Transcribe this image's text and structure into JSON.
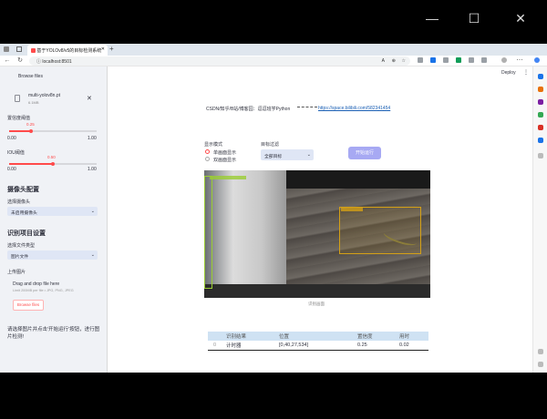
{
  "window": {
    "minimize_glyph": "—",
    "maximize_glyph": "☐",
    "close_glyph": "✕"
  },
  "browser": {
    "tab_title": "基于YOLOv8/v5的目标检测系统",
    "url": "localhost:8501"
  },
  "header": {
    "deploy_label": "Deploy",
    "menu_glyph": "⋮"
  },
  "sidebar": {
    "browse_top": "Browse files",
    "file_name": "multi-yolov8n.pt",
    "file_size": "6.1MB",
    "conf_label": "置信度阈值",
    "conf_value": "0.25",
    "conf_min": "0.00",
    "conf_max": "1.00",
    "conf_fraction": 0.25,
    "iou_label": "IOU阈值",
    "iou_value": "0.50",
    "iou_min": "0.00",
    "iou_max": "1.00",
    "iou_fraction": 0.5,
    "camera_heading": "摄像头配置",
    "camera_label": "选择摄像头",
    "camera_value": "未启用摄像头",
    "project_heading": "识别项目设置",
    "filetype_label": "选择文件类型",
    "filetype_value": "图片文件",
    "upload_label": "上传图片",
    "dropzone_title": "Drag and drop file here",
    "dropzone_limit": "Limit 200MB per file • JPG, PNG, JPEG",
    "browse_button": "Browse files",
    "hint": "请选择图片并点击'开始运行'按钮，进行图片检测!"
  },
  "main": {
    "author_line": "CSDN/知乎/B站/博客园：逗逗班学Python",
    "link": "https://space.bilibili.com/582341454",
    "display_mode_label": "显示模式",
    "mode_single": "单画面显示",
    "mode_dual": "双画面显示",
    "target_filter_label": "目标过滤",
    "target_filter_value": "全部目标",
    "run_button": "开始运行",
    "image_caption": "识别画面",
    "table": {
      "headers": [
        "",
        "识别结果",
        "位置",
        "置信度",
        "用时"
      ],
      "rows": [
        [
          "0",
          "计时器",
          "[0,40,27,534]",
          "0.25",
          "0.02"
        ]
      ]
    }
  },
  "colors": {
    "accent": "#ff4b4b",
    "run_button": "#a7a9f3",
    "table_header": "#cfe2f3",
    "sidebar_bg": "#f0f2f6"
  }
}
